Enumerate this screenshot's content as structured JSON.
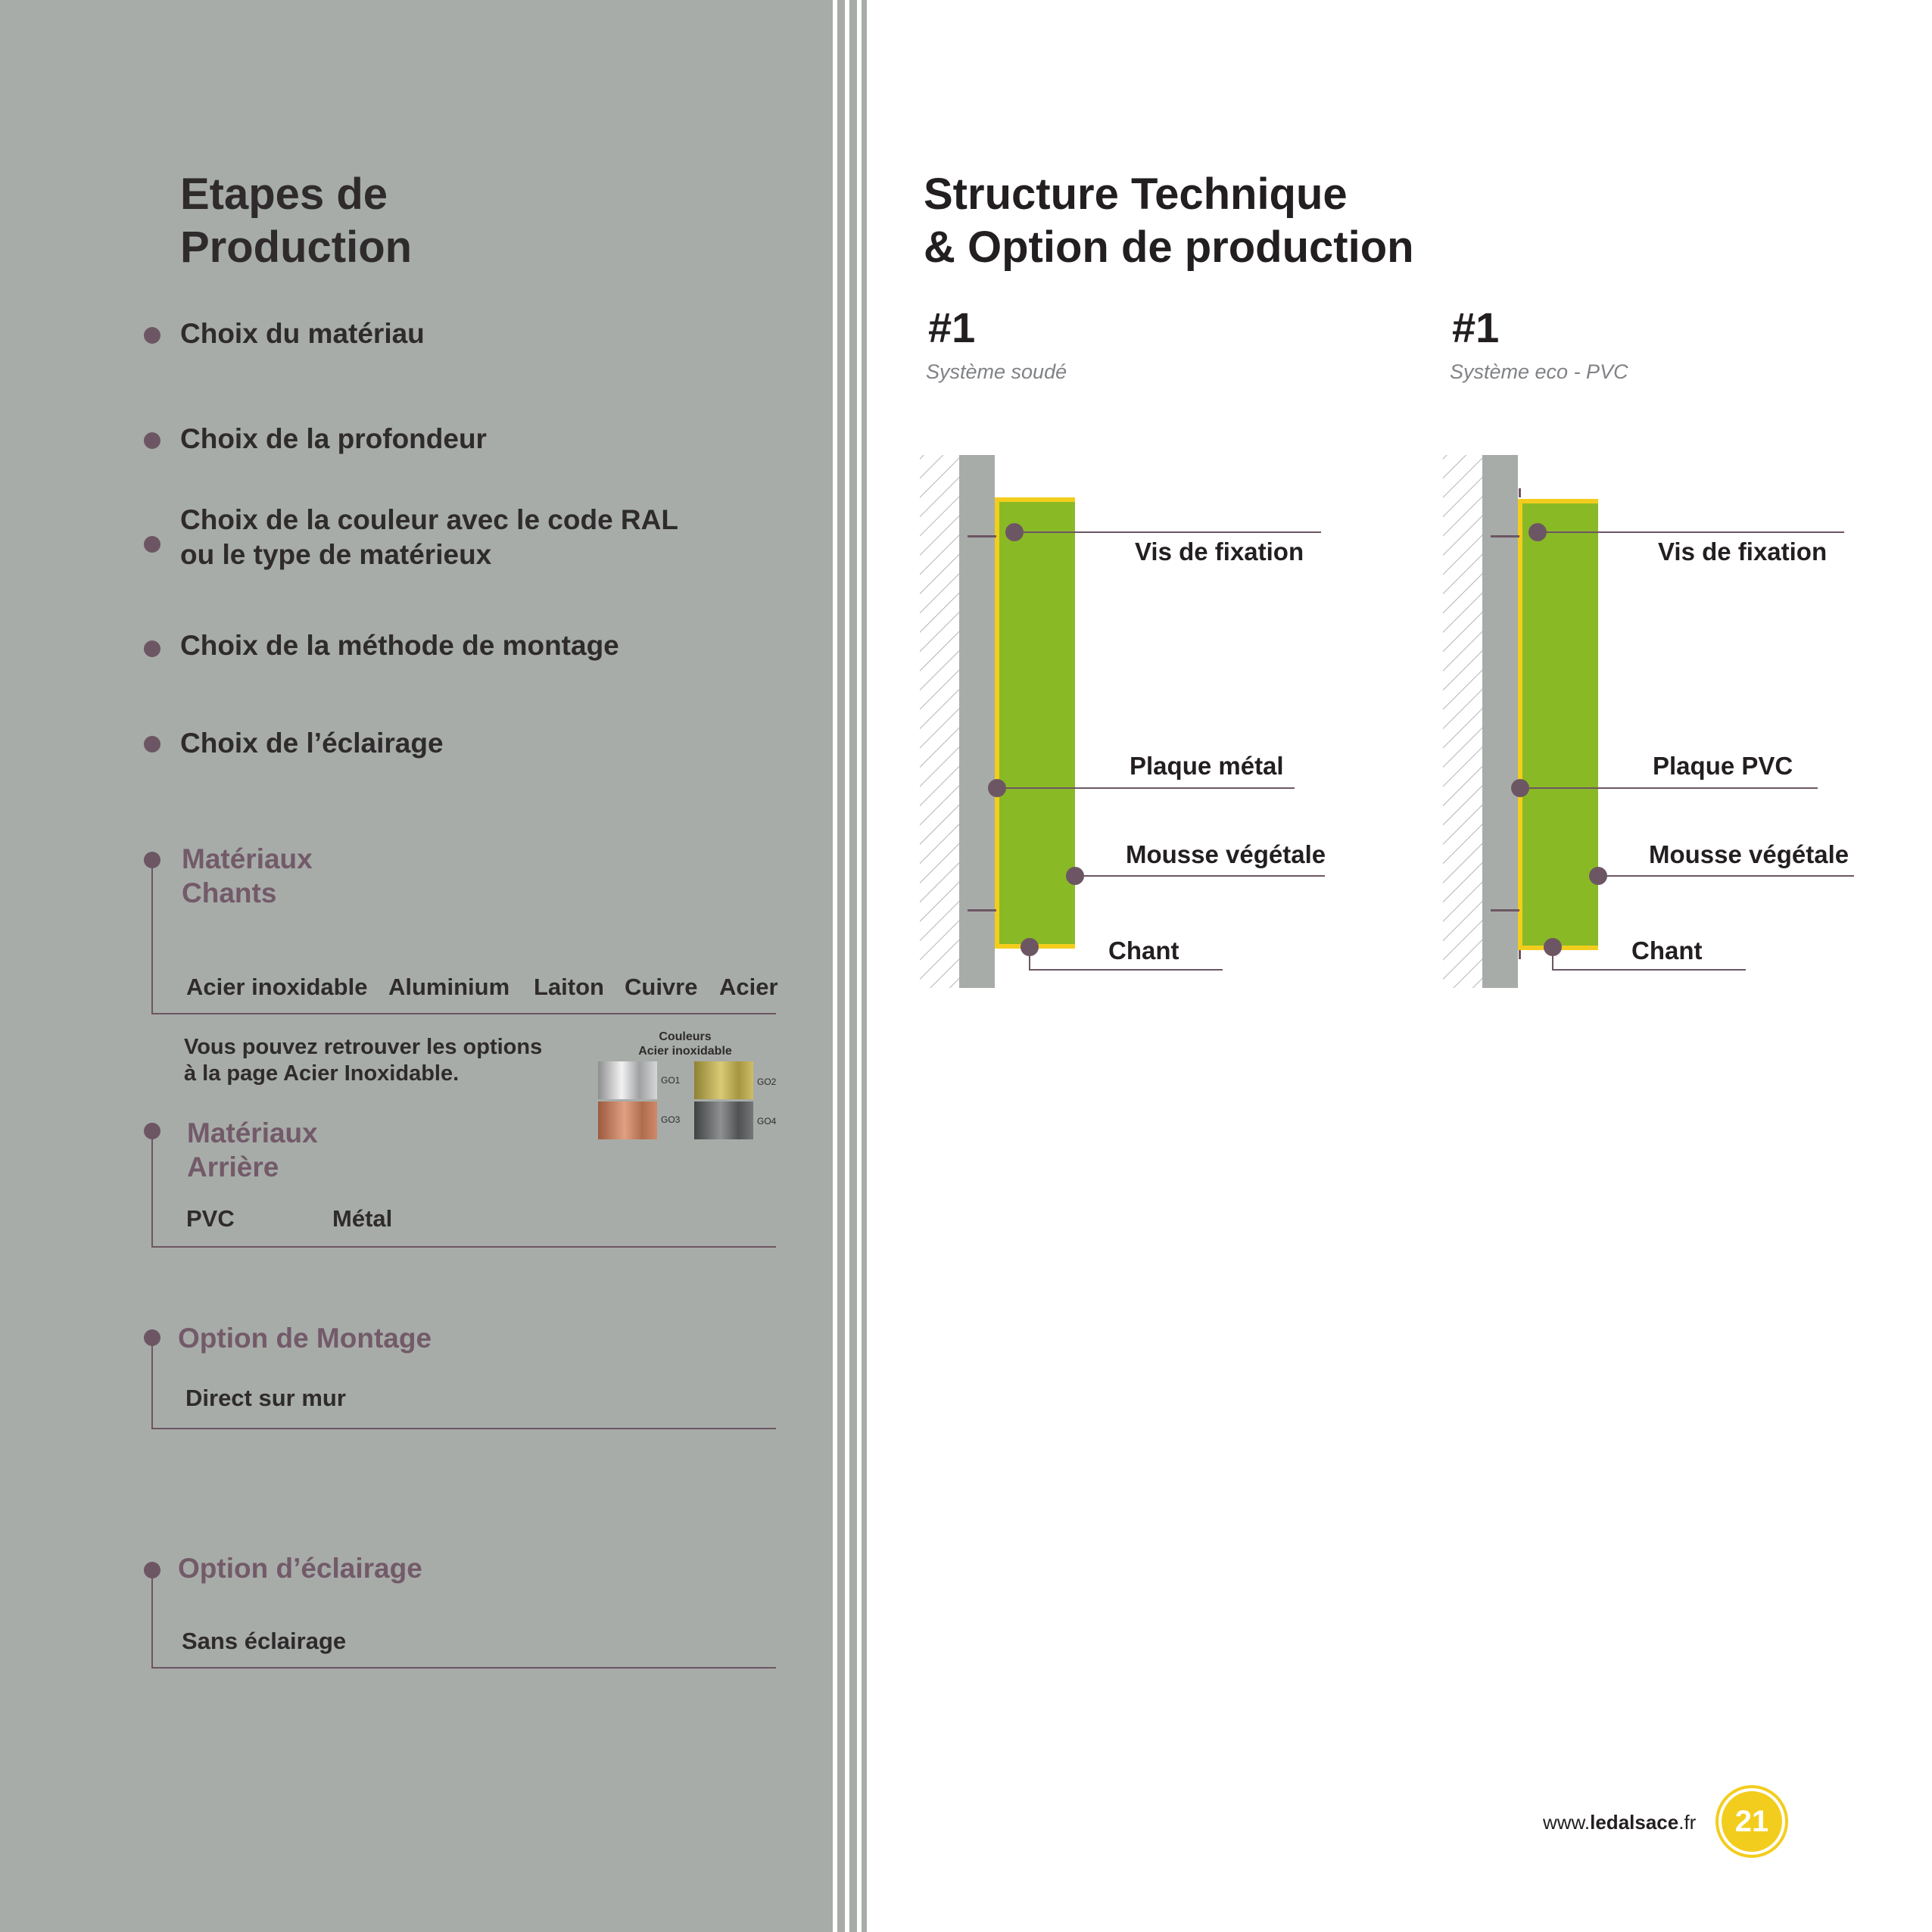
{
  "left": {
    "title_line1": "Etapes de",
    "title_line2": "Production",
    "steps": [
      "Choix du matériau",
      "Choix de la profondeur",
      "Choix de la couleur avec le code RAL",
      "ou le type de matérieux",
      "Choix de la méthode de montage",
      "Choix de l’éclairage"
    ],
    "chants": {
      "title_line1": "Matériaux",
      "title_line2": "Chants",
      "options": [
        "Acier inoxidable",
        "Aluminium",
        "Laiton",
        "Cuivre",
        "Acier"
      ]
    },
    "note_line1": "Vous pouvez retrouver les options",
    "note_line2": "à la page Acier Inoxidable.",
    "swatches": {
      "title_line1": "Couleurs",
      "title_line2": "Acier inoxidable",
      "codes": [
        "GO1",
        "GO2",
        "GO3",
        "GO4"
      ],
      "colors": [
        "#c9cacb",
        "#bfae4e",
        "#c0795a",
        "#5f6163"
      ]
    },
    "arriere": {
      "title_line1": "Matériaux",
      "title_line2": "Arrière",
      "options": [
        "PVC",
        "Métal"
      ]
    },
    "montage": {
      "title": "Option de Montage",
      "option": "Direct sur mur"
    },
    "eclairage": {
      "title": "Option d’éclairage",
      "option": "Sans éclairage"
    }
  },
  "right": {
    "title_line1": "Structure Technique",
    "title_line2": "& Option de production",
    "systems": [
      {
        "number": "#1",
        "subtitle": "Système soudé",
        "labels": [
          "Vis de fixation",
          "Plaque métal",
          "Mousse végétale",
          "Chant"
        ]
      },
      {
        "number": "#1",
        "subtitle": "Système eco - PVC",
        "labels": [
          "Vis de fixation",
          "Plaque PVC",
          "Mousse végétale",
          "Chant"
        ]
      }
    ]
  },
  "footer": {
    "url_prefix": "www.",
    "url_domain": "ledalsace",
    "url_suffix": ".fr",
    "page_number": "21"
  },
  "colors": {
    "panel_grey": "#a7aca8",
    "accent_purple": "#6d5663",
    "moss_green": "#8ab926",
    "edge_yellow": "#f3cd1d",
    "wall_grey": "#a7aca8"
  }
}
